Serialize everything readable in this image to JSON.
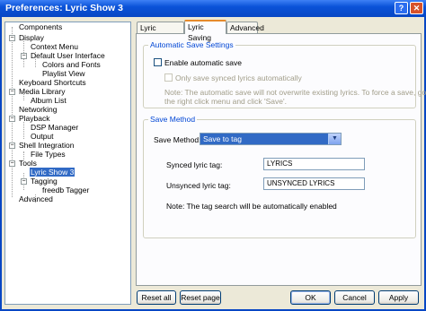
{
  "window": {
    "title": "Preferences: Lyric Show 3",
    "help_glyph": "?",
    "close_glyph": "✕"
  },
  "tree": {
    "expand_glyph": "−",
    "items": [
      {
        "label": "Components"
      },
      {
        "label": "Display"
      },
      {
        "label": "Context Menu"
      },
      {
        "label": "Default User Interface"
      },
      {
        "label": "Colors and Fonts"
      },
      {
        "label": "Playlist View"
      },
      {
        "label": "Keyboard Shortcuts"
      },
      {
        "label": "Media Library"
      },
      {
        "label": "Album List"
      },
      {
        "label": "Networking"
      },
      {
        "label": "Playback"
      },
      {
        "label": "DSP Manager"
      },
      {
        "label": "Output"
      },
      {
        "label": "Shell Integration"
      },
      {
        "label": "File Types"
      },
      {
        "label": "Tools"
      },
      {
        "label": "Lyric Show 3"
      },
      {
        "label": "Tagging"
      },
      {
        "label": "freedb Tagger"
      },
      {
        "label": "Advanced"
      }
    ]
  },
  "tabs": [
    {
      "label": "Lyric Searching"
    },
    {
      "label": "Lyric Saving"
    },
    {
      "label": "Advanced"
    }
  ],
  "auto_save": {
    "title": "Automatic Save Settings",
    "enable_label": "Enable automatic save",
    "only_synced_label": "Only save synced lyrics automatically",
    "note_line1": "Note: The automatic save will not overwrite existing lyrics. To force a save, go to",
    "note_line2": "the right click menu and click 'Save'."
  },
  "save_method": {
    "title": "Save Method",
    "method_label": "Save Method:",
    "method_value": "Save to tag",
    "arrow_glyph": "▼",
    "synced_label": "Synced lyric tag:",
    "synced_value": "LYRICS",
    "unsynced_label": "Unsynced lyric tag:",
    "unsynced_value": "UNSYNCED LYRICS",
    "note": "Note: The tag search will be automatically enabled"
  },
  "buttons": {
    "reset_all": "Reset all",
    "reset_page": "Reset page",
    "ok": "OK",
    "cancel": "Cancel",
    "apply": "Apply"
  }
}
